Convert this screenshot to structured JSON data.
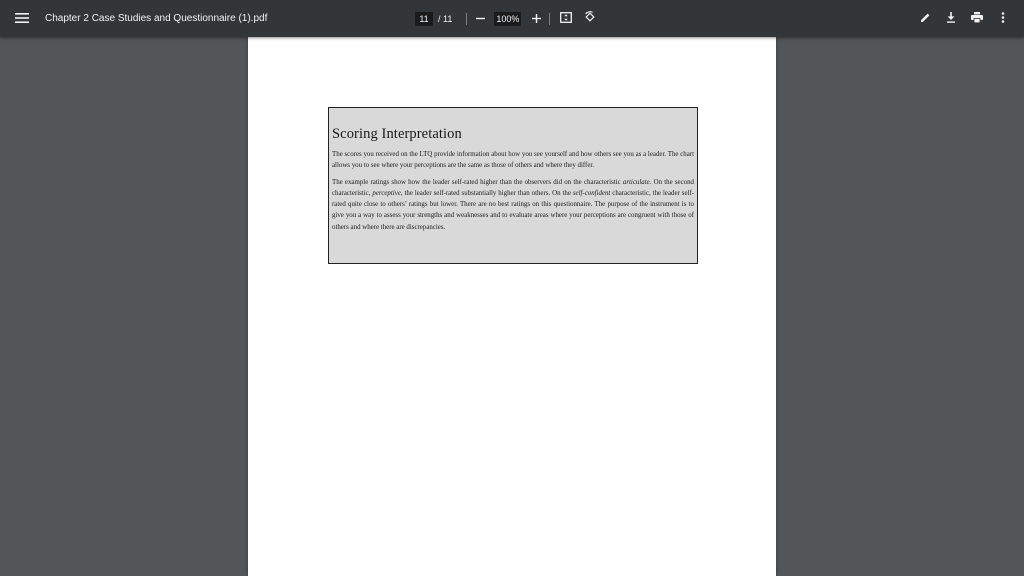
{
  "toolbar": {
    "file_name": "Chapter 2 Case Studies and Questionnaire (1).pdf",
    "current_page": "11",
    "page_total": "/ 11",
    "zoom": "100%",
    "icons": [
      "menu-icon",
      "zoom-out-icon",
      "zoom-in-icon",
      "fit-page-icon",
      "rotate-icon",
      "edit-icon",
      "download-icon",
      "print-icon",
      "more-icon"
    ]
  },
  "document": {
    "heading": "Scoring Interpretation",
    "paragraph1": "The scores you received on the LTQ provide information about how you see yourself and how others see you as a leader. The chart allows you to see where your perceptions are the same as those of others and where they differ.",
    "p2_a": "The example ratings show how the leader self-rated higher than the observers did on the characteristic ",
    "p2_b": "articulate",
    "p2_c": ". On the second characteristic, ",
    "p2_d": "perceptive",
    "p2_e": ", the leader self-rated substantially higher than others. On the ",
    "p2_f": "self-confident",
    "p2_g": " characteristic, the leader self-rated quite close to others’ ratings but lower. There are no best ratings on this questionnaire. The purpose of the instrument is to give you a way to assess your strengths and weaknesses and to evaluate areas where your perceptions are congruent with those of others and where there are discrepancies."
  },
  "colors": {
    "toolbar_bg": "#323639",
    "viewer_bg": "#525659",
    "box_bg": "#d9d9d9"
  }
}
